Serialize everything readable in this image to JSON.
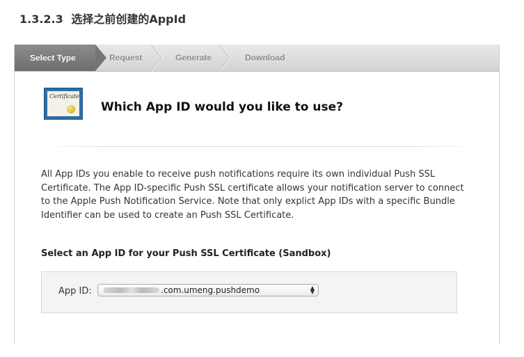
{
  "doc": {
    "section_number": "1.3.2.3",
    "section_title": "选择之前创建的AppId"
  },
  "steps": [
    {
      "label": "Select Type",
      "active": true
    },
    {
      "label": "Request",
      "active": false
    },
    {
      "label": "Generate",
      "active": false
    },
    {
      "label": "Download",
      "active": false
    }
  ],
  "panel": {
    "title": "Which App ID would you like to use?",
    "certificate_text": "Certificate",
    "certificate_icon": "certificate-icon",
    "description": "All App IDs you enable to receive push notifications require its own individual Push SSL Certificate. The App ID-specific Push SSL certificate allows your notification server to connect to the Apple Push Notification Service. Note that only explict App IDs with a specific Bundle Identifier can be used to create an Push SSL Certificate.",
    "select_heading": "Select an App ID for your Push SSL Certificate (Sandbox)",
    "appid_label": "App ID:",
    "appid_value": ".com.umeng.pushdemo"
  },
  "colors": {
    "active_step": "#757575",
    "cert_border": "#2f6ea6",
    "cert_seal": "#e2c93a"
  }
}
